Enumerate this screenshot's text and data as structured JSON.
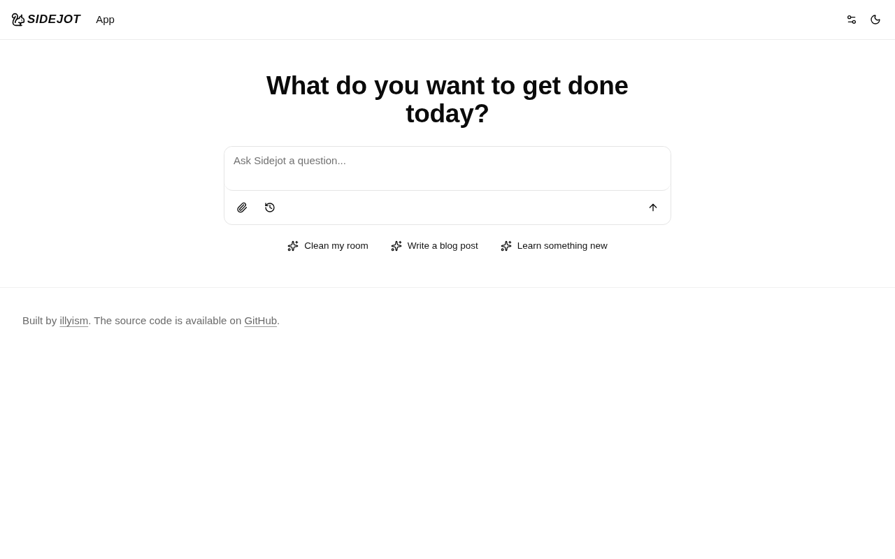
{
  "header": {
    "brand": "SIDEJOT",
    "nav_link": "App"
  },
  "heading": "What do you want to get done today?",
  "composer": {
    "placeholder": "Ask Sidejot a question..."
  },
  "suggestions": [
    "Clean my room",
    "Write a blog post",
    "Learn something new"
  ],
  "footer": {
    "prefix": "Built by",
    "author_link": "illyism",
    "middle": ". The source code is available on",
    "source_link": "GitHub",
    "suffix": "."
  }
}
